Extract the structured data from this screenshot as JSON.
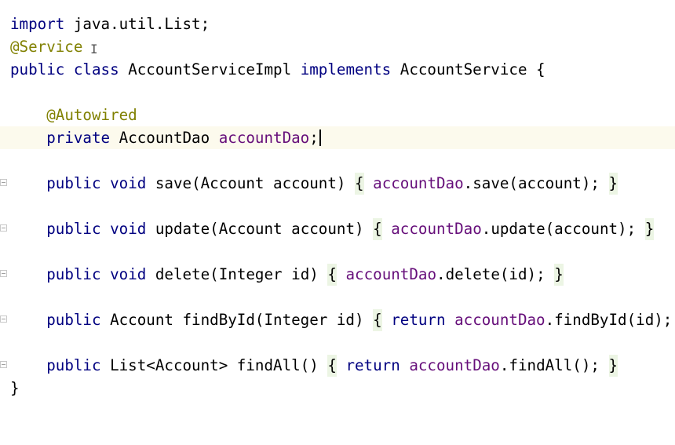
{
  "editor": {
    "lines": {
      "l1": {
        "kw": "import",
        "rest": " java.util.List;"
      },
      "l2": {
        "anno": "@Service"
      },
      "l3": {
        "kw1": "public",
        "kw2": "class",
        "name": " AccountServiceImpl ",
        "kw3": "implements",
        "rest": " AccountService {"
      },
      "l5": {
        "anno": "@Autowired"
      },
      "l6": {
        "kw": "private",
        "type": " AccountDao ",
        "field": "accountDao",
        "semi": ";"
      },
      "l8": {
        "kw1": "public",
        "kw2": "void",
        "sig": " save(Account account) ",
        "open": "{",
        "field": "accountDao",
        "call": ".save(account);",
        "close": "}"
      },
      "l10": {
        "kw1": "public",
        "kw2": "void",
        "sig": " update(Account account) ",
        "open": "{",
        "field": "accountDao",
        "call": ".update(account);",
        "close": "}"
      },
      "l12": {
        "kw1": "public",
        "kw2": "void",
        "sig": " delete(Integer id) ",
        "open": "{",
        "field": "accountDao",
        "call": ".delete(id);",
        "close": "}"
      },
      "l14": {
        "kw1": "public",
        "type": " Account findById(Integer id) ",
        "open": "{",
        "ret": "return",
        "field": "accountDao",
        "call": ".findById(id);",
        "close": "}"
      },
      "l16": {
        "kw1": "public",
        "type": " List<Account> findAll() ",
        "open": "{",
        "ret": "return",
        "field": "accountDao",
        "call": ".findAll();",
        "close": "}"
      },
      "l17": {
        "text": "}"
      }
    },
    "colors": {
      "keyword": "#000080",
      "annotation": "#808000",
      "field": "#660e7a",
      "current_line": "#fcfaed",
      "brace_fold": "#ecf5e4"
    }
  }
}
